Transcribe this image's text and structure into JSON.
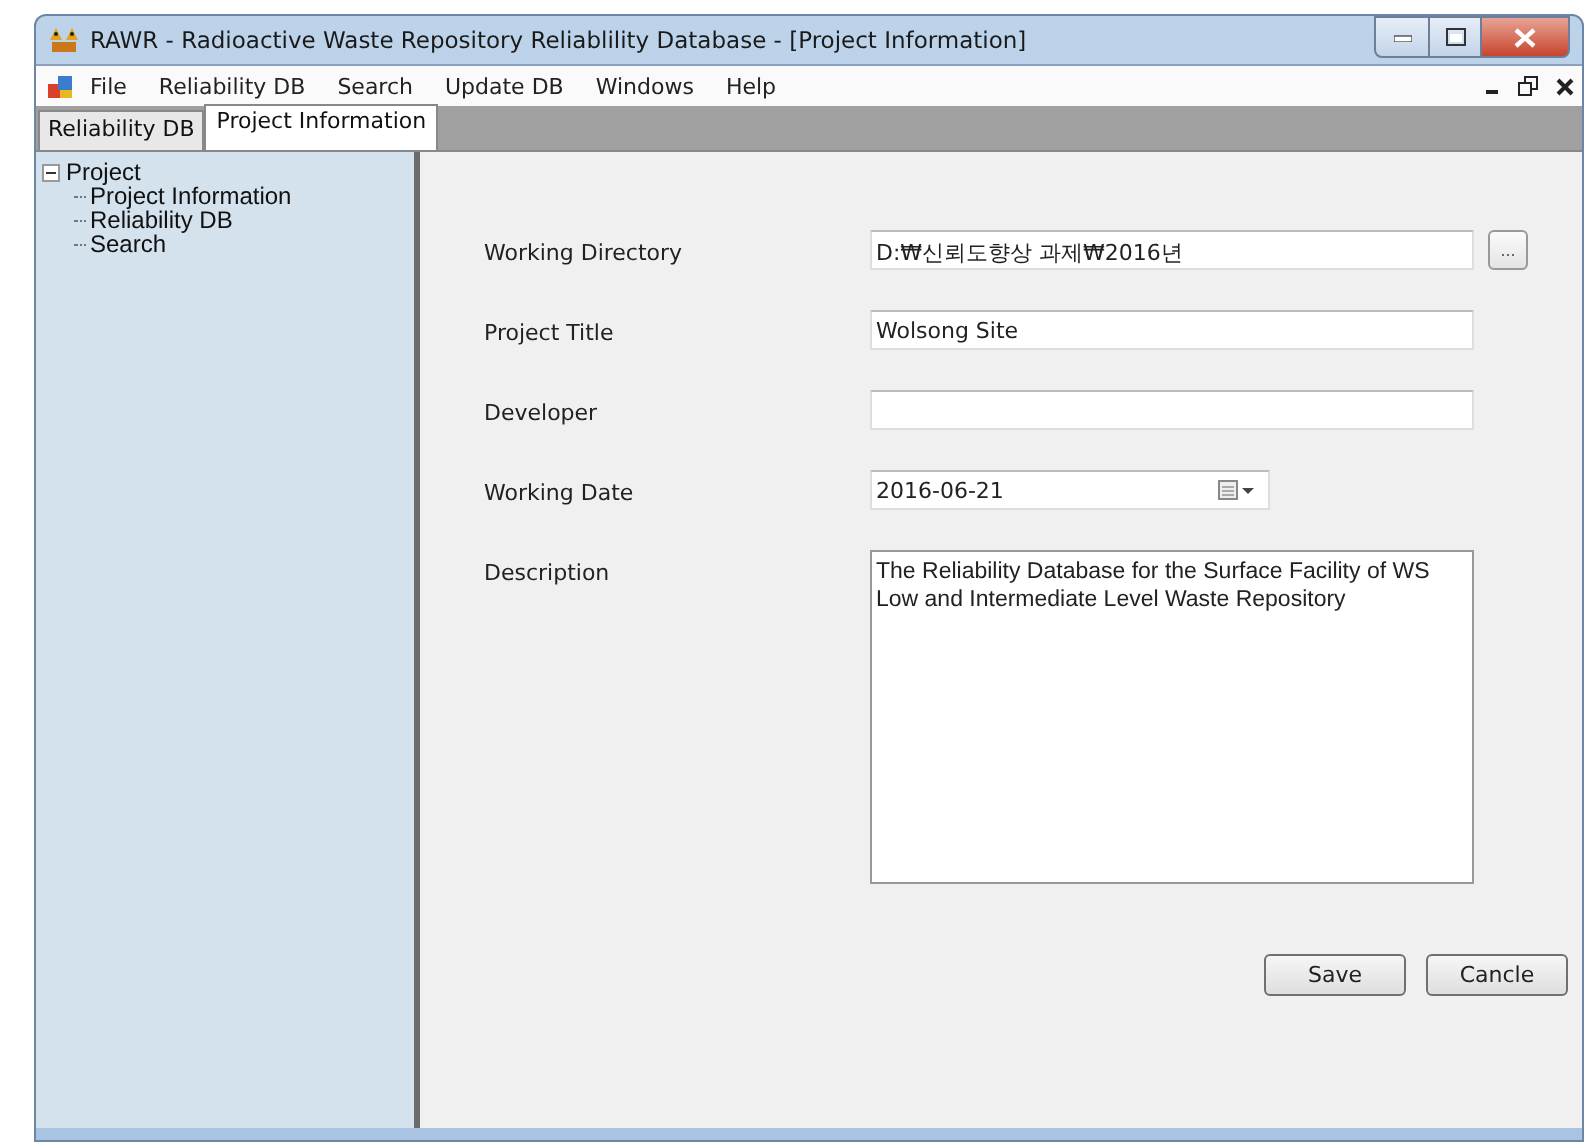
{
  "window": {
    "title": "RAWR - Radioactive Waste Repository Reliablility Database - [Project Information]"
  },
  "menu": [
    "File",
    "Reliability DB",
    "Search",
    "Update DB",
    "Windows",
    "Help"
  ],
  "tabs": [
    {
      "label": "Reliability DB",
      "selected": false
    },
    {
      "label": "Project Information",
      "selected": true
    }
  ],
  "tree": [
    {
      "label": "Project",
      "expanded": true,
      "children": [
        {
          "label": "Project Information"
        },
        {
          "label": "Reliability DB"
        },
        {
          "label": "Search"
        }
      ]
    }
  ],
  "form": {
    "fields": [
      {
        "kind": "browse",
        "label": "Working Directory",
        "value": "D:₩신뢰도향상 과제₩2016년",
        "button": "..."
      },
      {
        "kind": "text",
        "label": "Project Title",
        "value": "Wolsong Site"
      },
      {
        "kind": "text",
        "label": "Developer"
      },
      {
        "kind": "date",
        "label": "Working Date",
        "value": "2016-06-21"
      },
      {
        "kind": "multiline",
        "label": "Description",
        "value": "The Reliability Database for the Surface Facility of WS\nLow and Intermediate Level Waste Repository"
      }
    ],
    "buttons": [
      "Save",
      "Cancle"
    ]
  }
}
